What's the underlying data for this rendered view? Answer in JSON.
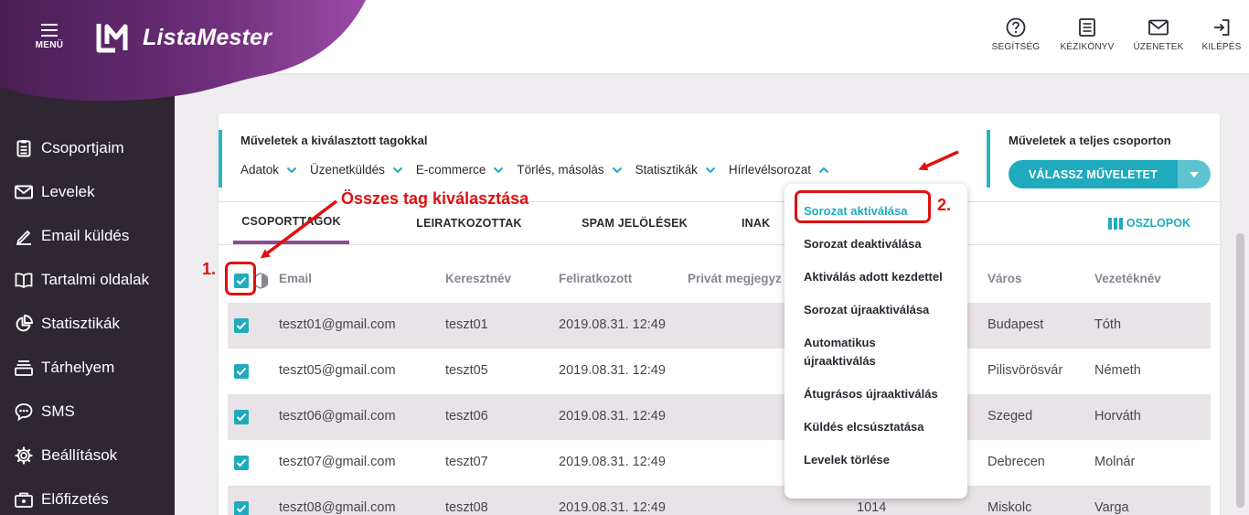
{
  "header": {
    "menu_label": "MENÜ",
    "logo_text": "ListaMester",
    "actions": [
      {
        "label": "SEGÍTSÉG",
        "icon": "help-circle-icon"
      },
      {
        "label": "KÉZIKÖNYV",
        "icon": "manual-icon"
      },
      {
        "label": "ÜZENETEK",
        "icon": "envelope-icon"
      },
      {
        "label": "KILÉPÉS",
        "icon": "logout-icon"
      }
    ]
  },
  "sidebar": {
    "items": [
      {
        "label": "Csoportjaim",
        "icon": "clipboard-list-icon"
      },
      {
        "label": "Levelek",
        "icon": "envelope-icon"
      },
      {
        "label": "Email küldés",
        "icon": "pencil-icon"
      },
      {
        "label": "Tartalmi oldalak",
        "icon": "book-icon"
      },
      {
        "label": "Statisztikák",
        "icon": "pie-chart-icon"
      },
      {
        "label": "Tárhelyem",
        "icon": "storage-icon"
      },
      {
        "label": "SMS",
        "icon": "chat-bubble-icon"
      },
      {
        "label": "Beállítások",
        "icon": "gear-icon"
      },
      {
        "label": "Előfizetés",
        "icon": "subscription-icon"
      }
    ]
  },
  "operations": {
    "selected_title": "Műveletek a kiválasztott tagokkal",
    "selected_items": [
      "Adatok",
      "Üzenetküldés",
      "E-commerce",
      "Törlés, másolás",
      "Statisztikák",
      "Hírlevélsorozat"
    ],
    "group_title": "Műveletek a teljes csoporton",
    "group_button": "VÁLASSZ MŰVELETET"
  },
  "tabs": [
    "CSOPORTTAGOK",
    "LEIRATKOZOTTAK",
    "SPAM JELÖLÉSEK",
    "INAK"
  ],
  "columns_button": "OSZLOPOK",
  "table": {
    "headers": [
      "Email",
      "Keresztnév",
      "Feliratkozott",
      "Privát megjegyz",
      "Város",
      "Vezetéknév"
    ],
    "rows": [
      {
        "email": "teszt01@gmail.com",
        "first": "teszt01",
        "date": "2019.08.31. 12:49",
        "extra": "",
        "city": "Budapest",
        "last": "Tóth"
      },
      {
        "email": "teszt05@gmail.com",
        "first": "teszt05",
        "date": "2019.08.31. 12:49",
        "extra": "",
        "city": "Pilisvörösvár",
        "last": "Németh"
      },
      {
        "email": "teszt06@gmail.com",
        "first": "teszt06",
        "date": "2019.08.31. 12:49",
        "extra": "",
        "city": "Szeged",
        "last": "Horváth"
      },
      {
        "email": "teszt07@gmail.com",
        "first": "teszt07",
        "date": "2019.08.31. 12:49",
        "extra": "",
        "city": "Debrecen",
        "last": "Molnár"
      },
      {
        "email": "teszt08@gmail.com",
        "first": "teszt08",
        "date": "2019.08.31. 12:49",
        "extra": "1014",
        "city": "Miskolc",
        "last": "Varga"
      }
    ]
  },
  "dropdown": {
    "items": [
      "Sorozat aktiválása",
      "Sorozat deaktiválása",
      "Aktiválás adott kezdettel",
      "Sorozat újraaktiválása",
      "Automatikus újraaktiválás",
      "Átugrásos újraaktiválás",
      "Küldés elcsúsztatása",
      "Levelek törlése"
    ]
  },
  "annotations": {
    "select_all_label": "Összes tag kiválasztása",
    "step1": "1.",
    "step2": "2."
  },
  "colors": {
    "accent": "#1faabe",
    "sidebar": "#2e2631",
    "brand_purple": "#8c4a93",
    "annotation_red": "#e01010"
  }
}
